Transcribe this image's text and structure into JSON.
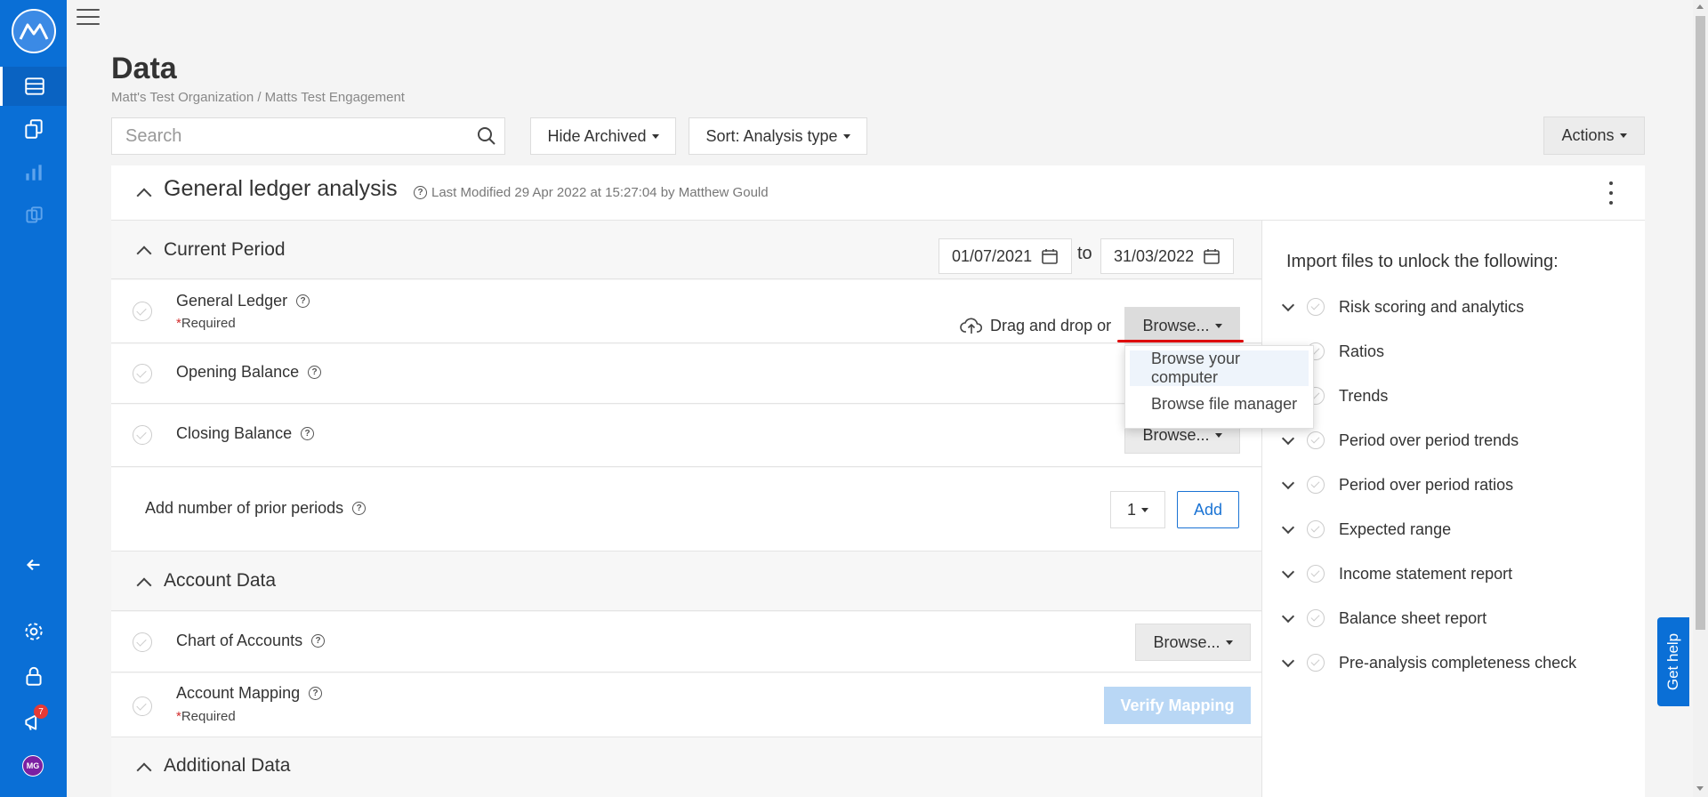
{
  "sidebar": {
    "notification_count": "7",
    "avatar_initials": "MG",
    "accent": "#0a6fd6"
  },
  "header": {
    "title": "Data",
    "breadcrumb": "Matt's Test Organization / Matts Test Engagement"
  },
  "toolbar": {
    "search_placeholder": "Search",
    "hide_archived_label": "Hide Archived",
    "sort_label": "Sort: Analysis type",
    "actions_label": "Actions"
  },
  "analysis": {
    "title": "General ledger analysis",
    "modified": "Last Modified 29 Apr 2022 at 15:27:04 by Matthew Gould"
  },
  "current_period": {
    "title": "Current Period",
    "start_date": "01/07/2021",
    "separator": "to",
    "end_date": "31/03/2022",
    "rows": {
      "general_ledger": {
        "label": "General Ledger",
        "required": "Required"
      },
      "opening_balance": {
        "label": "Opening Balance"
      },
      "closing_balance": {
        "label": "Closing Balance"
      }
    },
    "drag_text": "Drag and drop or",
    "browse_label": "Browse...",
    "prior_periods_label": "Add number of prior periods",
    "prior_periods_value": "1",
    "add_label": "Add"
  },
  "browse_menu": {
    "items": [
      "Browse your computer",
      "Browse file manager"
    ]
  },
  "account_data": {
    "title": "Account Data",
    "chart_of_accounts": "Chart of Accounts",
    "account_mapping": "Account Mapping",
    "required": "Required",
    "verify_label": "Verify Mapping"
  },
  "additional_data": {
    "title": "Additional Data"
  },
  "unlock": {
    "title": "Import files to unlock the following:",
    "items": [
      "Risk scoring and analytics",
      "Ratios",
      "Trends",
      "Period over period trends",
      "Period over period ratios",
      "Expected range",
      "Income statement report",
      "Balance sheet report",
      "Pre-analysis completeness check"
    ]
  },
  "help_tab": "Get help"
}
